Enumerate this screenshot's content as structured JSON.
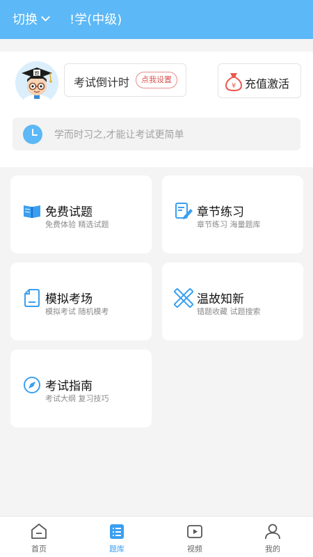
{
  "header": {
    "switch_label": "切换",
    "subject": "!学(中级)"
  },
  "countdown": {
    "label": "考试倒计时",
    "set_button": "点我设置"
  },
  "recharge": {
    "label": "充值激活"
  },
  "motto": "学而时习之,才能让考试更简单",
  "cards": [
    {
      "title": "免费试题",
      "desc": "免费体验 精选试题",
      "icon": "open-book-icon"
    },
    {
      "title": "章节练习",
      "desc": "章节练习 海量题库",
      "icon": "document-pen-icon"
    },
    {
      "title": "模拟考场",
      "desc": "模拟考试 随机模考",
      "icon": "document-icon"
    },
    {
      "title": "温故知新",
      "desc": "错题收藏 试题搜索",
      "icon": "ruler-pencil-icon"
    },
    {
      "title": "考试指南",
      "desc": "考试大纲 复习技巧",
      "icon": "compass-icon"
    }
  ],
  "tabs": [
    {
      "label": "首页",
      "icon": "home-icon",
      "active": false
    },
    {
      "label": "题库",
      "icon": "question-bank-icon",
      "active": true
    },
    {
      "label": "视频",
      "icon": "video-icon",
      "active": false
    },
    {
      "label": "我的",
      "icon": "profile-icon",
      "active": false
    }
  ],
  "colors": {
    "primary": "#5cb8f6",
    "accent_blue": "#3a9ff0",
    "set_button_red": "#d9534f",
    "moneybag_red": "#e8594f"
  }
}
